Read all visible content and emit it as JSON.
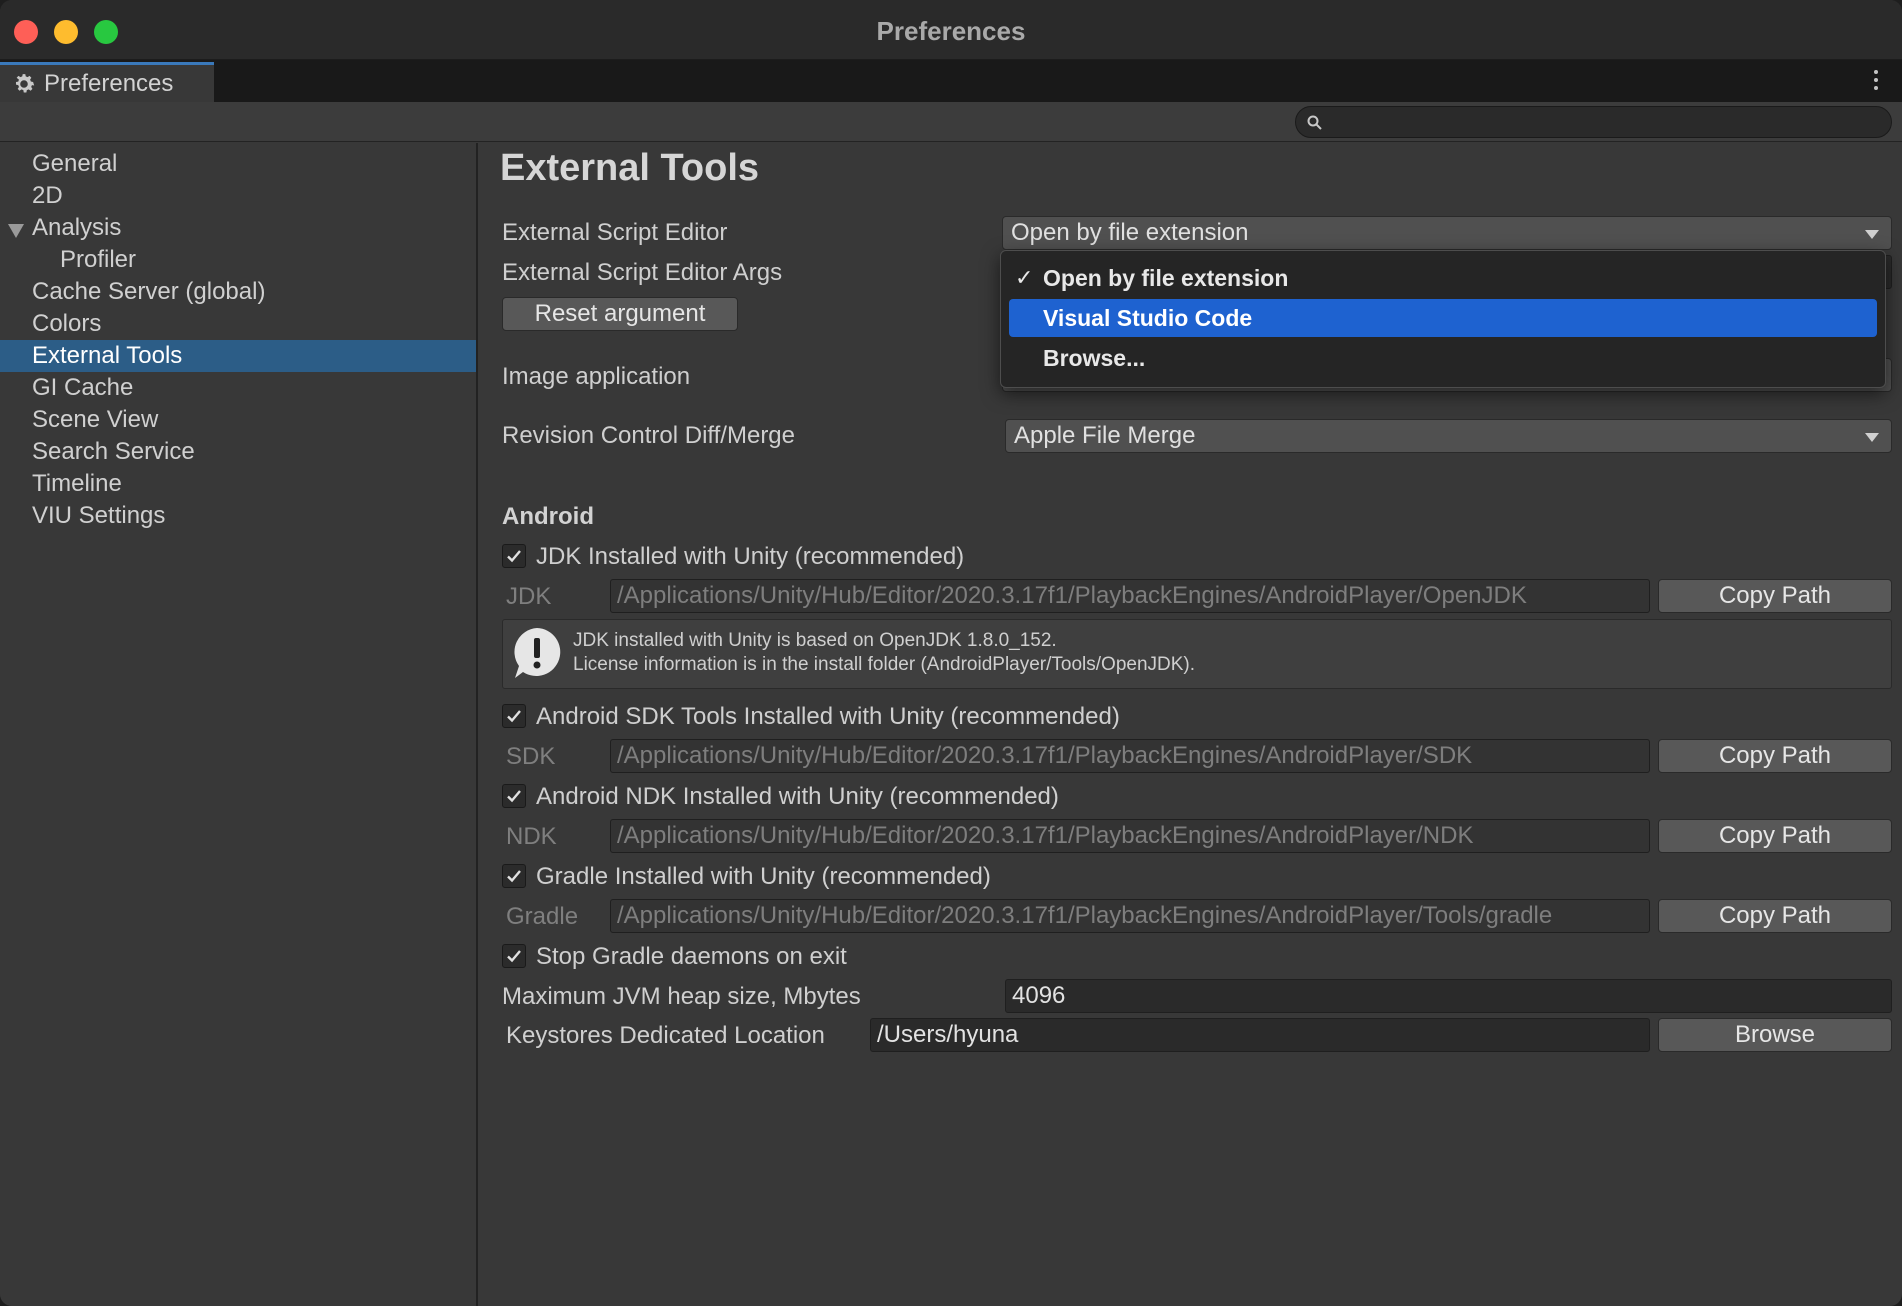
{
  "window": {
    "title": "Preferences"
  },
  "tab": {
    "label": "Preferences"
  },
  "search": {
    "placeholder": ""
  },
  "sidebar": {
    "items": [
      {
        "label": "General"
      },
      {
        "label": "2D"
      },
      {
        "label": "Analysis"
      },
      {
        "label": "Profiler"
      },
      {
        "label": "Cache Server (global)"
      },
      {
        "label": "Colors"
      },
      {
        "label": "External Tools"
      },
      {
        "label": "GI Cache"
      },
      {
        "label": "Scene View"
      },
      {
        "label": "Search Service"
      },
      {
        "label": "Timeline"
      },
      {
        "label": "VIU Settings"
      }
    ],
    "selected": "External Tools"
  },
  "main": {
    "title": "External Tools",
    "script_editor_label": "External Script Editor",
    "script_editor_value": "Open by file extension",
    "script_editor_args_label": "External Script Editor Args",
    "reset_argument": "Reset argument",
    "image_application_label": "Image application",
    "revision_control_label": "Revision Control Diff/Merge",
    "revision_control_value": "Apple File Merge"
  },
  "menu": {
    "items": [
      {
        "label": "Open by file extension",
        "checked": true
      },
      {
        "label": "Visual Studio Code",
        "highlighted": true
      },
      {
        "label": "Browse..."
      }
    ],
    "check_glyph": "✓"
  },
  "android": {
    "title": "Android",
    "jdk_checkbox": "JDK Installed with Unity (recommended)",
    "jdk_label": "JDK",
    "jdk_path": "/Applications/Unity/Hub/Editor/2020.3.17f1/PlaybackEngines/AndroidPlayer/OpenJDK",
    "jdk_info_line1": "JDK installed with Unity is based on OpenJDK 1.8.0_152.",
    "jdk_info_line2": "License information is in the install folder (AndroidPlayer/Tools/OpenJDK).",
    "sdk_checkbox": "Android SDK Tools Installed with Unity (recommended)",
    "sdk_label": "SDK",
    "sdk_path": "/Applications/Unity/Hub/Editor/2020.3.17f1/PlaybackEngines/AndroidPlayer/SDK",
    "ndk_checkbox": "Android NDK Installed with Unity (recommended)",
    "ndk_label": "NDK",
    "ndk_path": "/Applications/Unity/Hub/Editor/2020.3.17f1/PlaybackEngines/AndroidPlayer/NDK",
    "gradle_checkbox": "Gradle Installed with Unity (recommended)",
    "gradle_label": "Gradle",
    "gradle_path": "/Applications/Unity/Hub/Editor/2020.3.17f1/PlaybackEngines/AndroidPlayer/Tools/gradle",
    "stop_gradle_checkbox": "Stop Gradle daemons on exit",
    "jvm_heap_label": "Maximum JVM heap size, Mbytes",
    "jvm_heap_value": "4096",
    "keystores_label": "Keystores Dedicated Location",
    "keystores_value": "/Users/hyuna",
    "copy_path": "Copy Path",
    "browse": "Browse"
  },
  "colors": {
    "accent_selected": "#2c5d87",
    "menu_highlight": "#1e62d0",
    "close": "#fe5f57",
    "minimize": "#febc2e",
    "zoom": "#28c840"
  }
}
